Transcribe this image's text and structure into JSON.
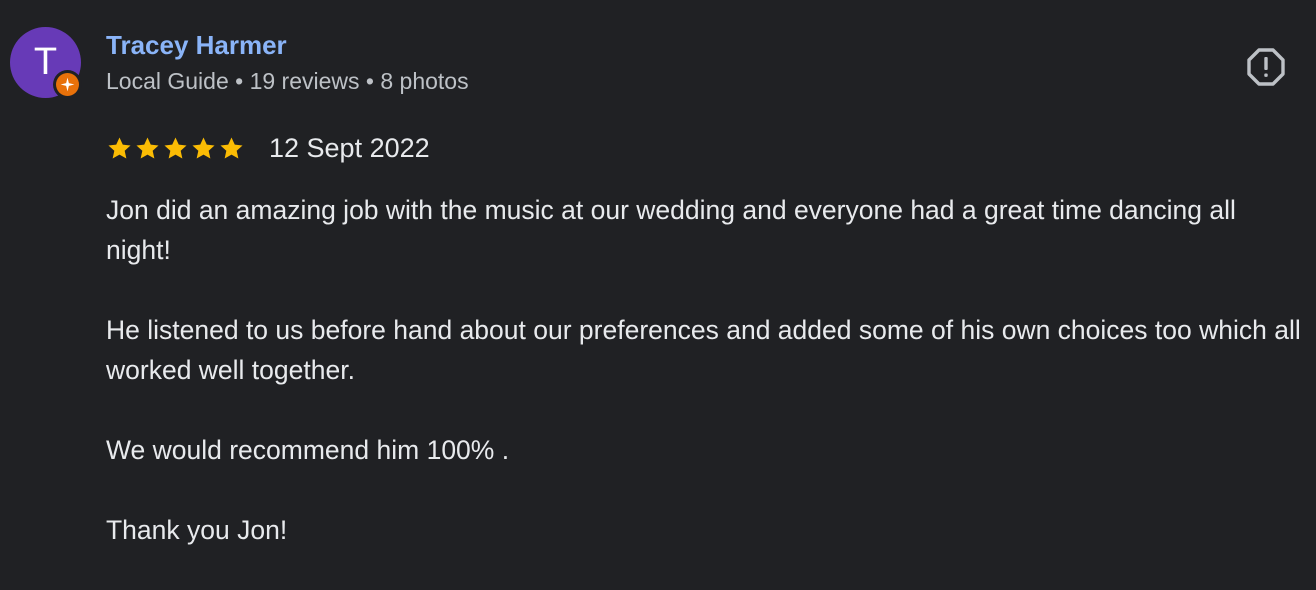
{
  "reviewer": {
    "initial": "T",
    "name": "Tracey Harmer",
    "meta": "Local Guide • 19 reviews • 8 photos",
    "avatar_color": "#673ab7",
    "badge_color": "#e8710a",
    "badge_icon": "local-guide-star-icon"
  },
  "review": {
    "rating": 5,
    "rating_max": 5,
    "star_color": "#fbbc04",
    "date": "12 Sept 2022",
    "paragraphs": [
      "Jon did an amazing job with the music at our wedding and everyone had a great time dancing all night!",
      "He listened to us before hand about our preferences and added some of his own choices too which all worked well together.",
      "We would recommend him 100% .",
      "Thank you Jon!"
    ]
  },
  "actions": {
    "report_icon": "report-icon"
  }
}
